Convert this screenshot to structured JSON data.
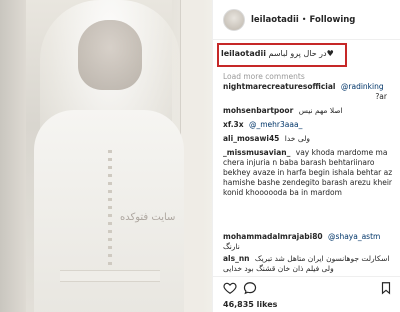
{
  "photo": {
    "watermark": "سایت فتوکده"
  },
  "post": {
    "username": "leilaotadii",
    "dot": "•",
    "follow_label": "Following",
    "caption_user": "leilaotadii",
    "caption_text": "در حال پرو لباسم♥",
    "load_more": "Load more comments",
    "likes": "46,835 likes"
  },
  "comments": [
    {
      "user": "nightmarecreaturesofficial",
      "mention": "@radinking",
      "text": ""
    },
    {
      "user": "",
      "mention": "",
      "text": "?ar"
    },
    {
      "user": "mohsenbartpoor",
      "mention": "",
      "text": "اصلا مهم نیس"
    },
    {
      "user": "xf.3x",
      "mention": "@_mehr3aaa_",
      "text": ""
    },
    {
      "user": "ali_mosawi45",
      "mention": "",
      "text": "ولی خدا"
    },
    {
      "user": "_missmusavian_",
      "mention": "",
      "text": "vay khoda mardome ma chera injuria n baba barash behtariinaro bekhey avaze in harfa begin ishala behtar az hamishe bashe zendegito barash arezu kheir konid khoooooda ba in mardom"
    },
    {
      "user": "mohammadalmrajabi80",
      "mention": "@shaya_astm",
      "text": "نارنگ"
    },
    {
      "user": "als_nn",
      "mention": "",
      "text": "اسکارلت جوهانسون ایران متاهل شد تبریک ولی فیلم ذان خان قشنگ بود خدایی"
    }
  ],
  "icons": {
    "like": "heart-icon",
    "comment": "comment-icon",
    "bookmark": "bookmark-icon"
  }
}
